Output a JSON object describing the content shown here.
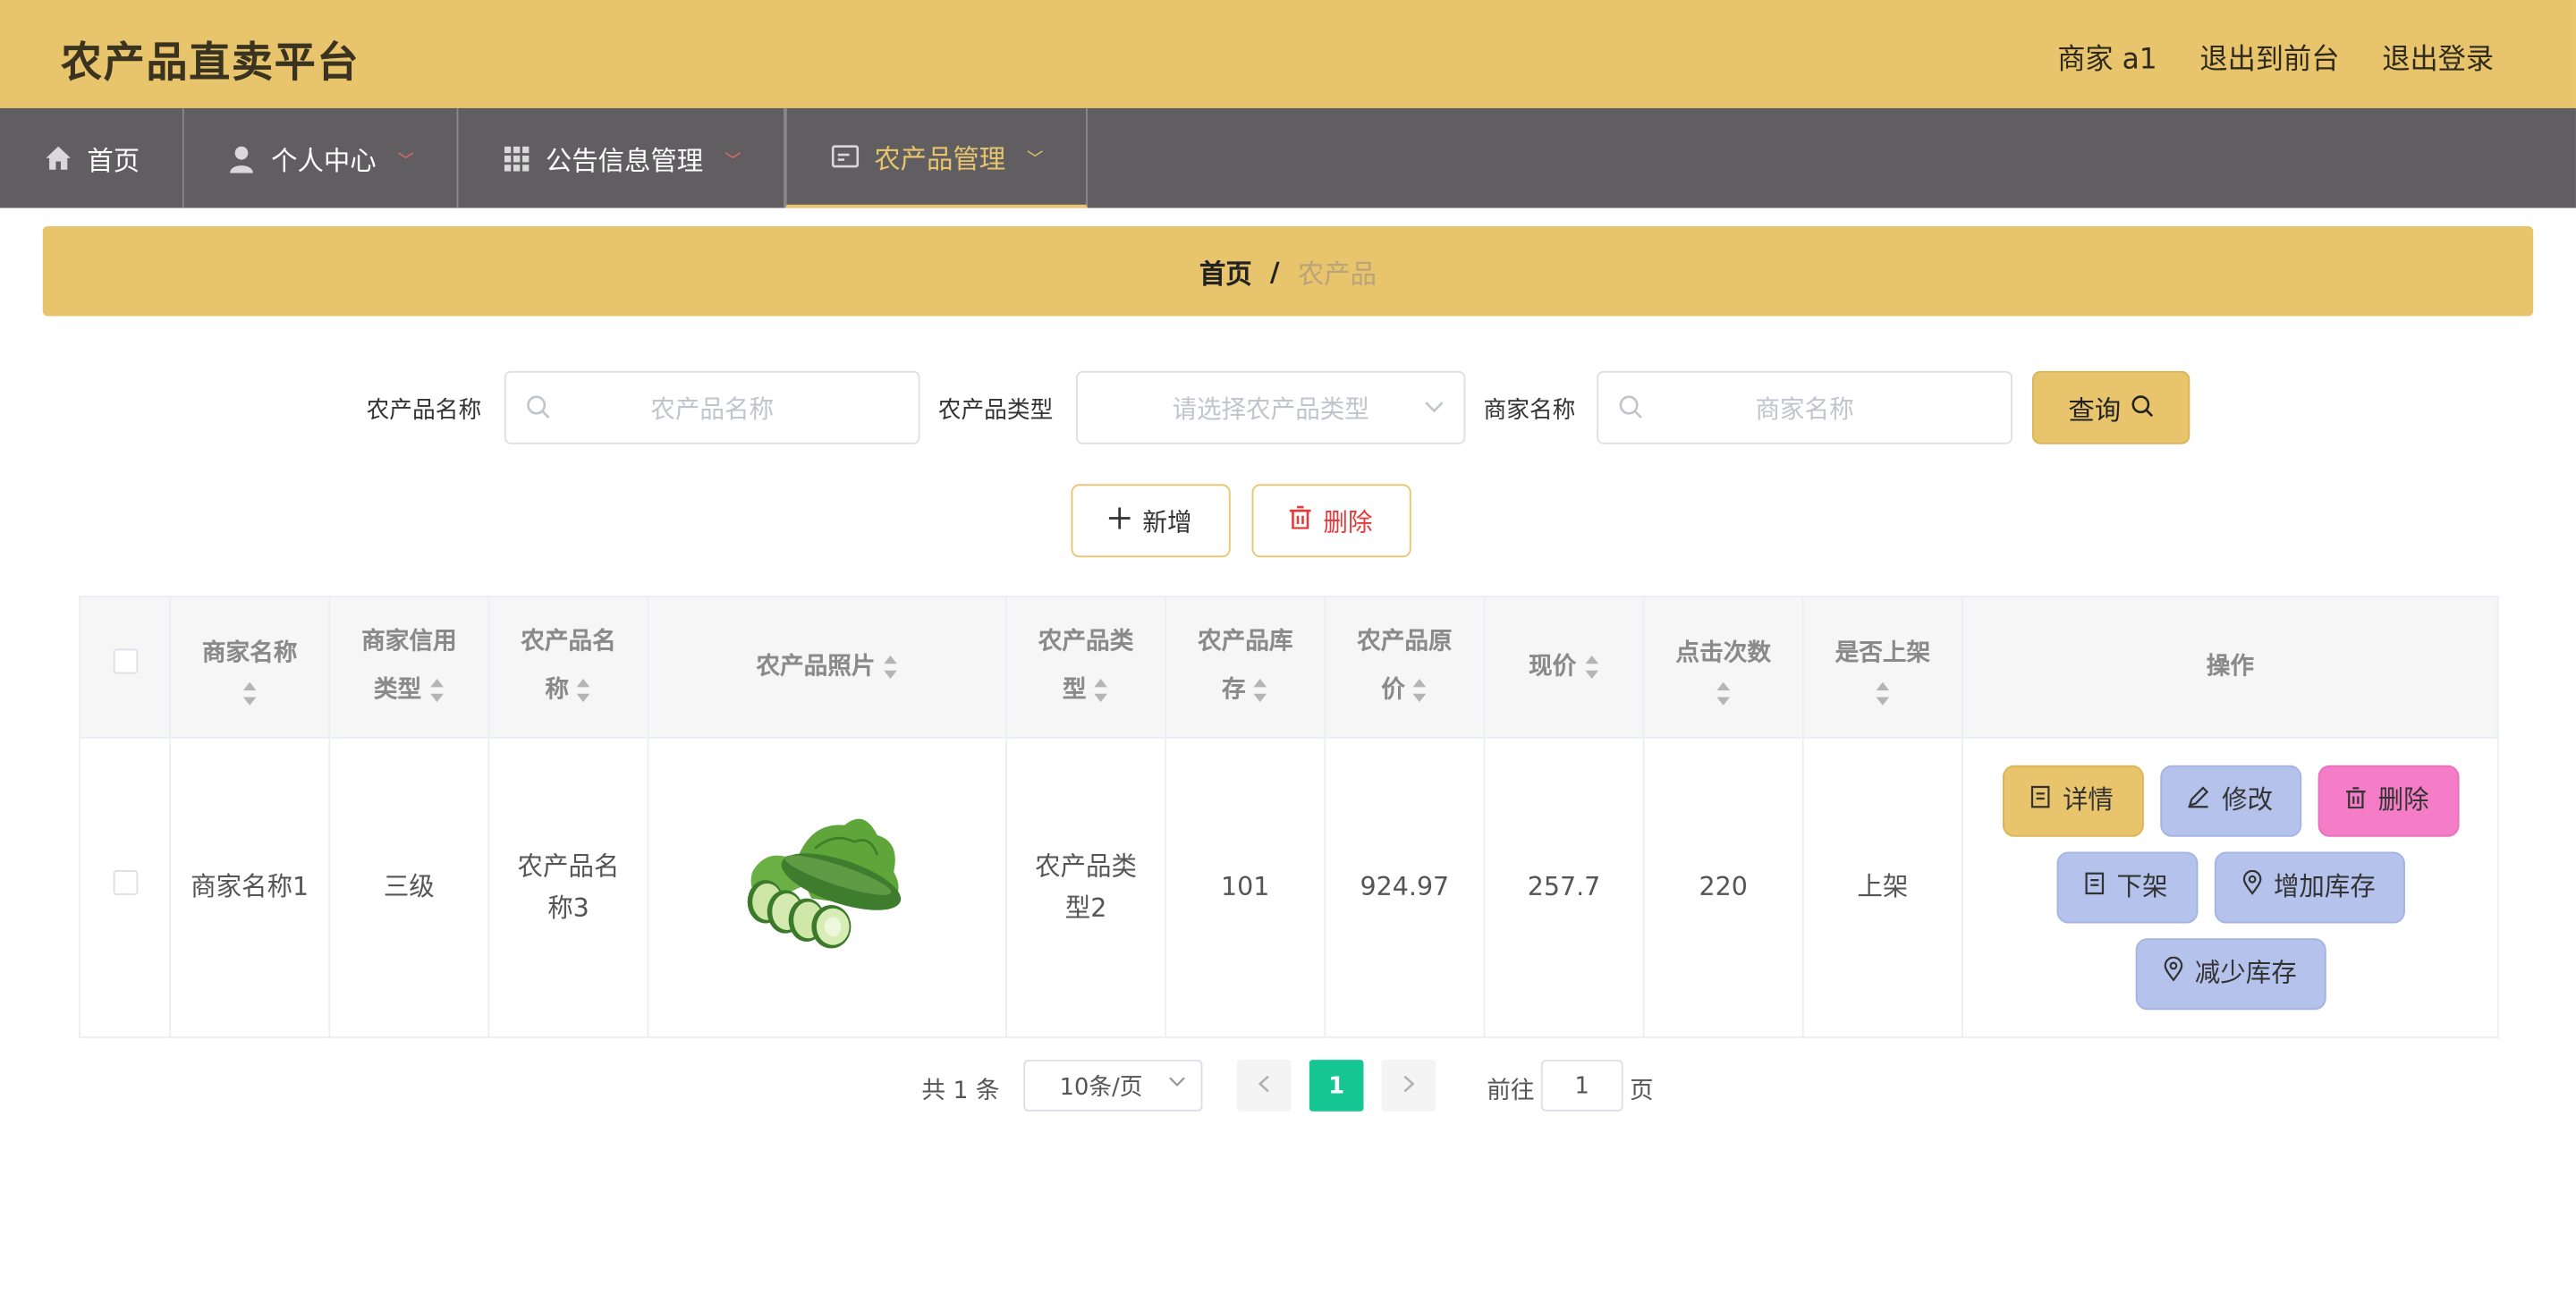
{
  "header": {
    "title": "农产品直卖平台",
    "user_label": "商家 a1",
    "to_front_label": "退出到前台",
    "logout_label": "退出登录"
  },
  "nav": {
    "items": [
      {
        "label": "首页",
        "icon": "home-icon"
      },
      {
        "label": "个人中心",
        "icon": "user-icon"
      },
      {
        "label": "公告信息管理",
        "icon": "grid-icon"
      },
      {
        "label": "农产品管理",
        "icon": "card-icon",
        "active": true
      }
    ]
  },
  "breadcrumb": {
    "home": "首页",
    "separator": "/",
    "current": "农产品"
  },
  "filters": {
    "name_label": "农产品名称",
    "name_placeholder": "农产品名称",
    "type_label": "农产品类型",
    "type_placeholder": "请选择农产品类型",
    "merchant_label": "商家名称",
    "merchant_placeholder": "商家名称",
    "query_label": "查询"
  },
  "actions": {
    "add_label": "新增",
    "delete_label": "删除"
  },
  "table": {
    "columns": [
      "商家名称",
      "商家信用类型",
      "农产品名称",
      "农产品照片",
      "农产品类型",
      "农产品库存",
      "农产品原价",
      "现价",
      "点击次数",
      "是否上架",
      "操作"
    ],
    "header_lines": {
      "merchant": "商家名称",
      "credit_1": "商家信用",
      "credit_2": "类型",
      "pname_1": "农产品名",
      "pname_2": "称",
      "photo": "农产品照片",
      "ptype_1": "农产品类",
      "ptype_2": "型",
      "stock_1": "农产品库",
      "stock_2": "存",
      "orig_1": "农产品原",
      "orig_2": "价",
      "price": "现价",
      "clicks": "点击次数",
      "listed": "是否上架",
      "ops": "操作"
    },
    "rows": [
      {
        "merchant": "商家名称1",
        "credit": "三级",
        "pname_1": "农产品名",
        "pname_2": "称3",
        "ptype_1": "农产品类",
        "ptype_2": "型2",
        "stock": "101",
        "original_price": "924.97",
        "price": "257.7",
        "clicks": "220",
        "listed": "上架",
        "ops": {
          "detail": "详情",
          "edit": "修改",
          "delete": "删除",
          "off": "下架",
          "add_stock": "增加库存",
          "sub_stock": "减少库存"
        }
      }
    ]
  },
  "pagination": {
    "total": "共 1 条",
    "page_size": "10条/页",
    "current_page": "1",
    "goto_label": "前往",
    "goto_value": "1",
    "page_suffix": "页"
  },
  "colors": {
    "accent": "#e8c56d",
    "nav_bg": "#605e60",
    "action_blue": "#b5c2ec",
    "action_pink": "#f57dc8",
    "pager_active": "#16c693"
  }
}
